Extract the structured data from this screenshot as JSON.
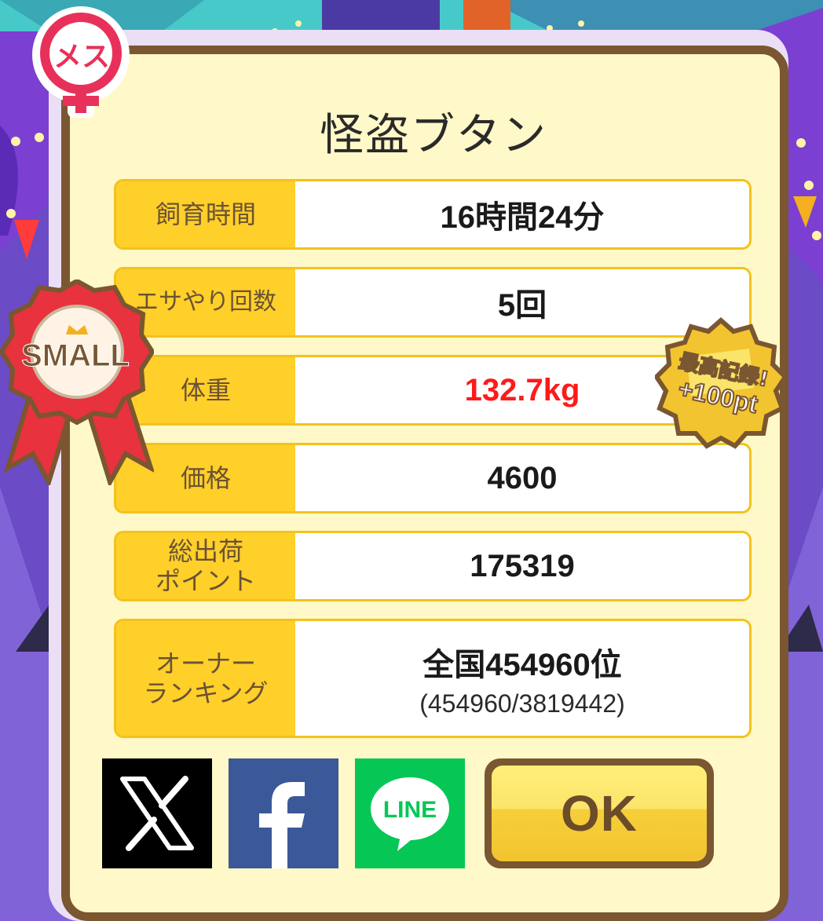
{
  "character_name": "怪盗ブタン",
  "gender_badge": {
    "text": "メス",
    "icon": "female-icon",
    "color": "#e8315a"
  },
  "size_ribbon": {
    "text": "SMALL",
    "icon": "ribbon-medal-icon"
  },
  "record_seal": {
    "line1": "最高記録!",
    "line2": "+100pt"
  },
  "stats": [
    {
      "label": "飼育時間",
      "value": "16時間24分"
    },
    {
      "label": "エサやり回数",
      "value": "5回"
    },
    {
      "label": "体重",
      "value": "132.7kg",
      "highlight": "#ff1a1a"
    },
    {
      "label": "価格",
      "value": "4600"
    },
    {
      "label_line1": "総出荷",
      "label_line2": "ポイント",
      "value": "175319"
    },
    {
      "label_line1": "オーナー",
      "label_line2": "ランキング",
      "value": "全国454960位",
      "sub": "(454960/3819442)"
    }
  ],
  "share_buttons": [
    {
      "icon": "x-logo-icon"
    },
    {
      "icon": "facebook-icon"
    },
    {
      "icon": "line-icon",
      "text": "LINE"
    }
  ],
  "ok_button": {
    "label": "OK"
  },
  "colors": {
    "panel_bg": "#fff8c8",
    "panel_border": "#7a5631",
    "label_bg": "#ffcf2a"
  }
}
